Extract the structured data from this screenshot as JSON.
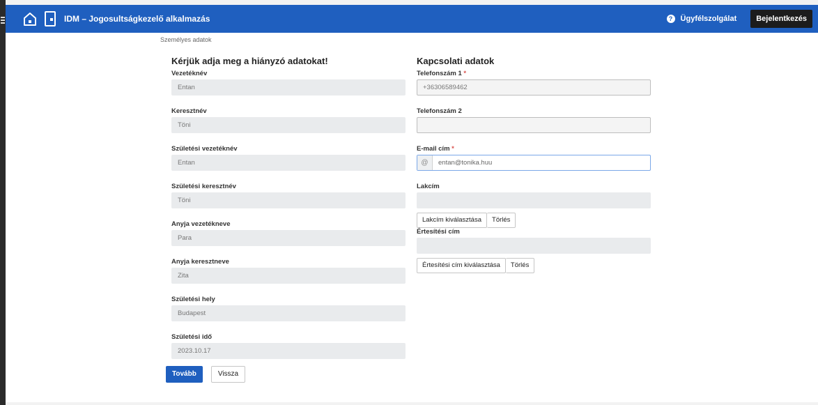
{
  "header": {
    "title": "IDM – Jogosultságkezelő alkalmazás",
    "help_label": "Ügyfélszolgálat",
    "login_label": "Bejelentkezés"
  },
  "breadcrumb": "Személyes adatok",
  "personal": {
    "title": "Kérjük adja meg a hiányzó adatokat!",
    "fields": [
      {
        "label": "Vezetéknév",
        "value": "Entan"
      },
      {
        "label": "Keresztnév",
        "value": "Töni"
      },
      {
        "label": "Születési vezetéknév",
        "value": "Entan"
      },
      {
        "label": "Születési keresztnév",
        "value": "Töni"
      },
      {
        "label": "Anyja vezetékneve",
        "value": "Para"
      },
      {
        "label": "Anyja keresztneve",
        "value": "Zita"
      },
      {
        "label": "Születési hely",
        "value": "Budapest"
      },
      {
        "label": "Születési idő",
        "value": "2023.10.17"
      }
    ]
  },
  "contact": {
    "title": "Kapcsolati adatok",
    "phone1_label": "Telefonszám 1",
    "phone1_value": "+36306589462",
    "phone2_label": "Telefonszám 2",
    "phone2_value": "",
    "email_label": "E-mail cím",
    "email_prefix": "@",
    "email_value": "entan@tonika.huu",
    "address_label": "Lakcím",
    "address_value": "",
    "address_select_label": "Lakcím kiválasztása",
    "address_clear_label": "Törlés",
    "notify_label": "Értesítési cím",
    "notify_value": "",
    "notify_select_label": "Értesítési cím kiválasztása",
    "notify_clear_label": "Törlés",
    "required_mark": "*"
  },
  "actions": {
    "next_label": "Tovább",
    "back_label": "Vissza"
  },
  "colors": {
    "header_bg": "#1f5fbf",
    "primary_button": "#1f5fbf",
    "required": "#d9534f"
  }
}
